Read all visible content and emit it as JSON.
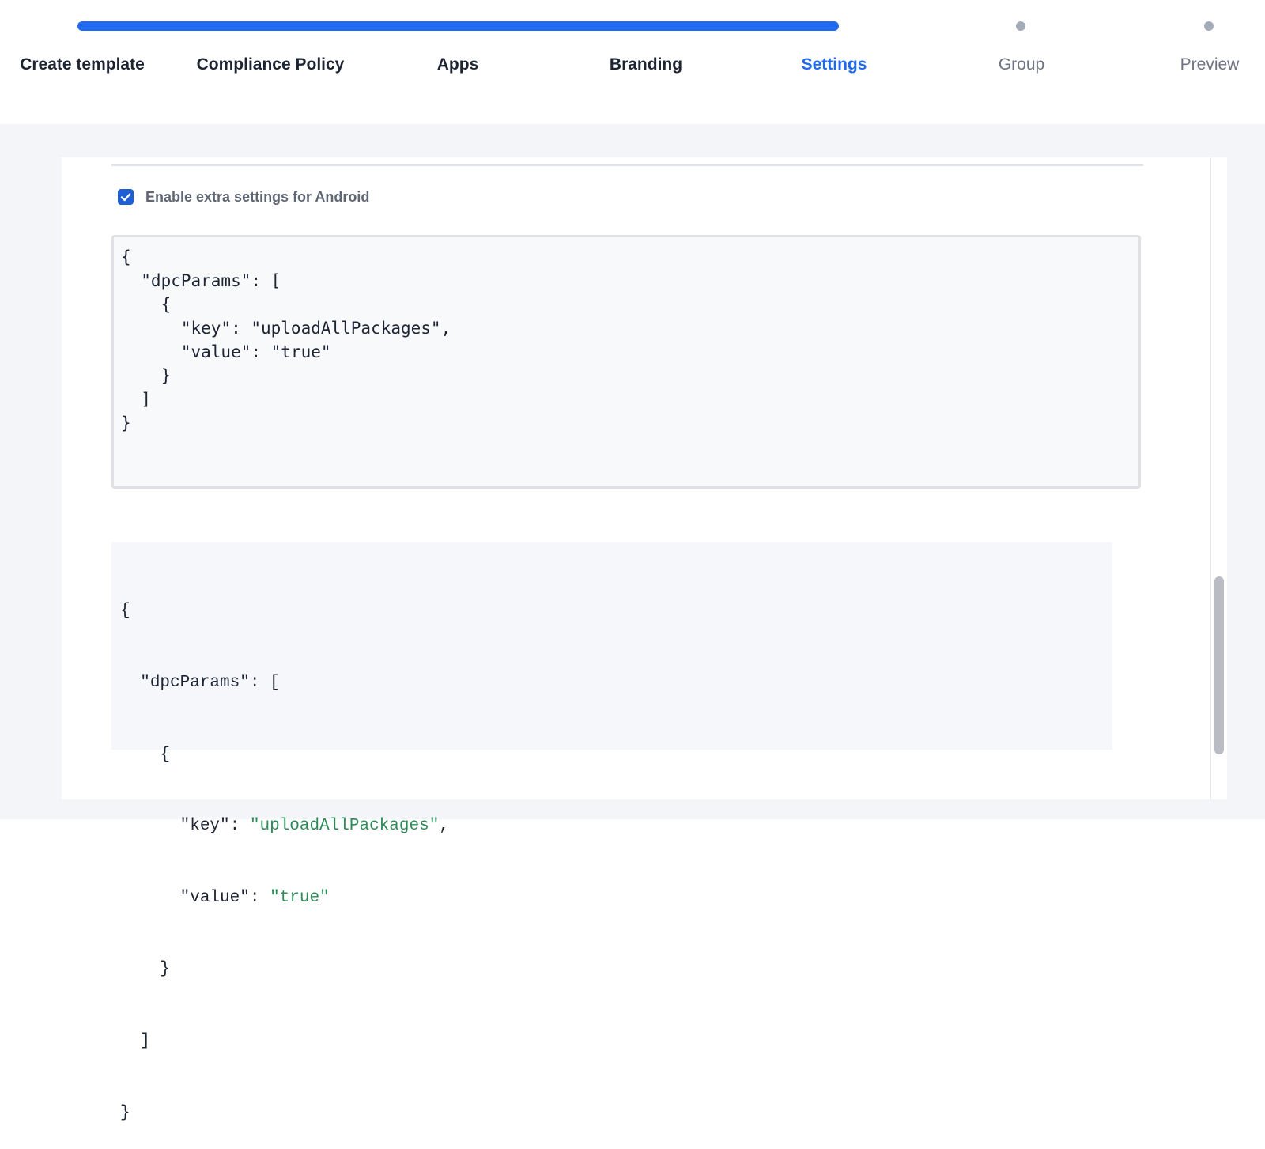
{
  "stepper": {
    "progress_percent": 80,
    "steps": [
      {
        "label": "Create template",
        "state": "done"
      },
      {
        "label": "Compliance Policy",
        "state": "done"
      },
      {
        "label": "Apps",
        "state": "done"
      },
      {
        "label": "Branding",
        "state": "done"
      },
      {
        "label": "Settings",
        "state": "active"
      },
      {
        "label": "Group",
        "state": "pending"
      },
      {
        "label": "Preview",
        "state": "pending"
      }
    ]
  },
  "android_settings": {
    "checkbox_label": "Enable extra settings for Android",
    "checked": true,
    "editor_value": "{\n  \"dpcParams\": [\n    {\n      \"key\": \"uploadAllPackages\",\n      \"value\": \"true\"\n    }\n  ]\n}",
    "preview": {
      "open_brace": "{",
      "params_key": "\"dpcParams\"",
      "colon": ":",
      "open_bracket": "[",
      "item_open": "{",
      "key_key": "\"key\"",
      "key_value": "\"uploadAllPackages\"",
      "comma": ",",
      "value_key": "\"value\"",
      "value_value": "\"true\"",
      "item_close": "}",
      "close_bracket": "]",
      "close_brace": "}"
    }
  },
  "colors": {
    "accent": "#1f6af0",
    "json_string": "#2e8b57",
    "page_background": "#f4f5f9"
  }
}
